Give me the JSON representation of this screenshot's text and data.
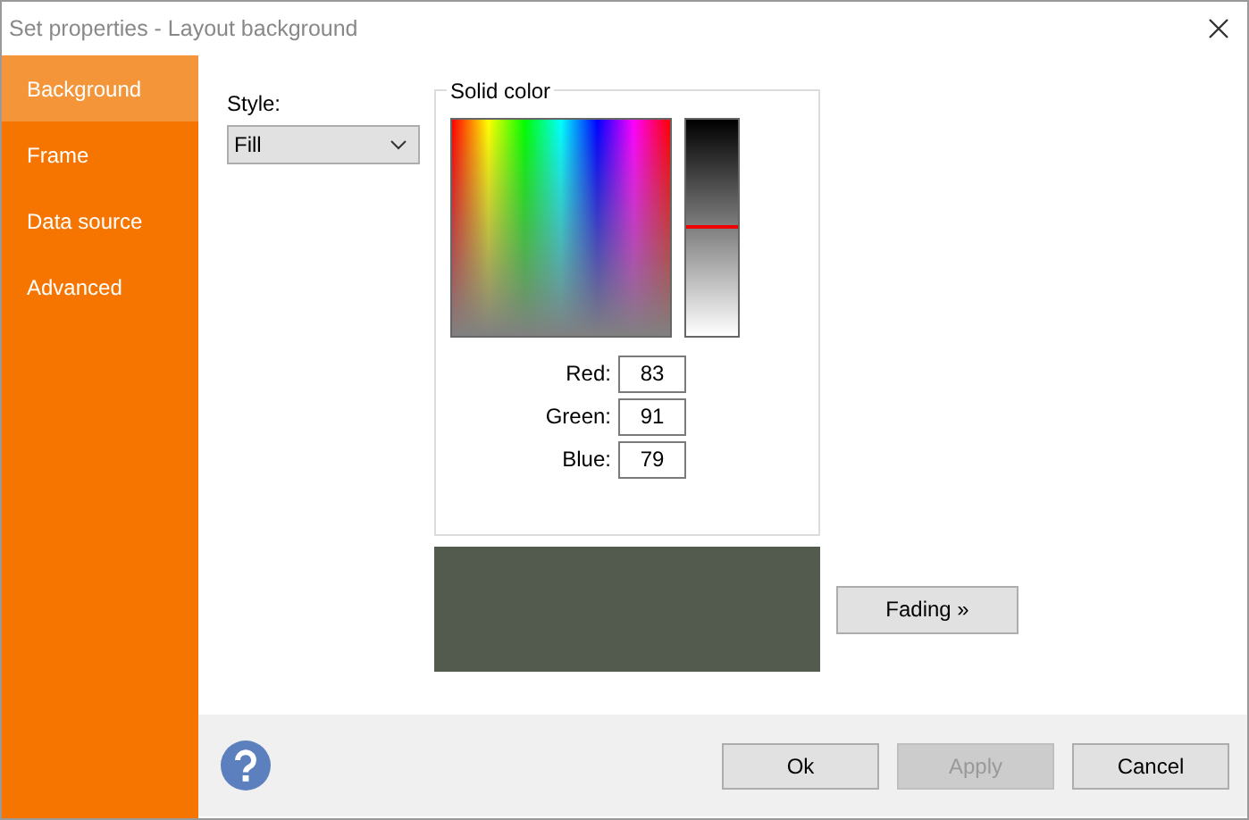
{
  "window": {
    "title": "Set properties - Layout background"
  },
  "sidebar": {
    "items": [
      {
        "label": "Background",
        "selected": true
      },
      {
        "label": "Frame",
        "selected": false
      },
      {
        "label": "Data source",
        "selected": false
      },
      {
        "label": "Advanced",
        "selected": false
      }
    ]
  },
  "style": {
    "label": "Style:",
    "value": "Fill"
  },
  "solid_color": {
    "title": "Solid color",
    "lightness": {
      "level": 0.51
    },
    "channels": [
      {
        "label": "Red:",
        "value": "83"
      },
      {
        "label": "Green:",
        "value": "91"
      },
      {
        "label": "Blue:",
        "value": "79"
      }
    ]
  },
  "fading_button": {
    "label": "Fading »"
  },
  "buttons": [
    {
      "label": "Ok",
      "disabled": false
    },
    {
      "label": "Apply",
      "disabled": true
    },
    {
      "label": "Cancel",
      "disabled": false
    }
  ]
}
